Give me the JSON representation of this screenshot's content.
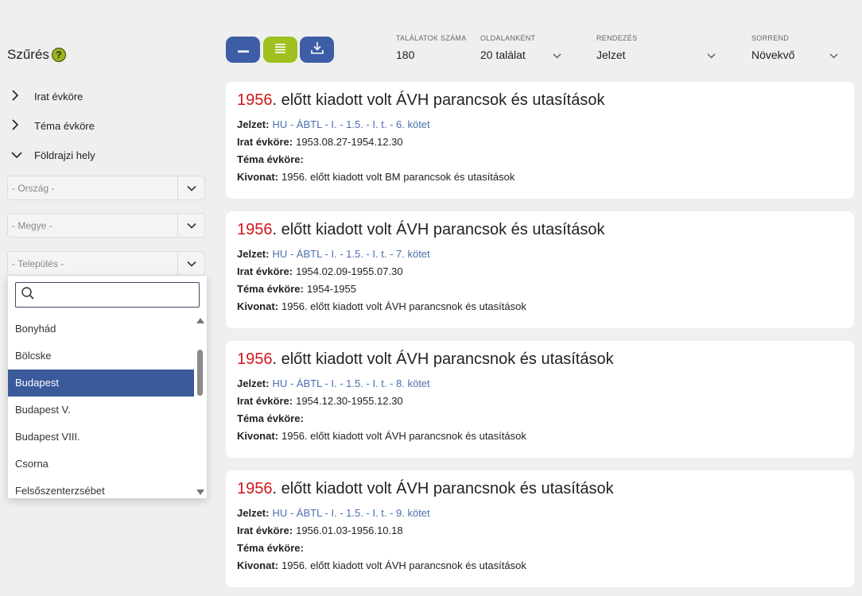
{
  "sidebar": {
    "title": "Szűrés",
    "help": "?",
    "facets": [
      {
        "label": "Irat évköre",
        "state": "collapsed"
      },
      {
        "label": "Téma évköre",
        "state": "collapsed"
      },
      {
        "label": "Földrajzi hely",
        "state": "expanded"
      }
    ],
    "selects": [
      {
        "placeholder": "- Ország -"
      },
      {
        "placeholder": "- Megye -"
      },
      {
        "placeholder": "- Település -"
      }
    ],
    "dropdown": {
      "search_value": "",
      "items": [
        "Bonyhád",
        "Bölcske",
        "Budapest",
        "Budapest V.",
        "Budapest VIII.",
        "Csorna",
        "Felsőszenterzsébet"
      ],
      "selected": "Budapest"
    }
  },
  "toolbar": {
    "results_label": "TALÁLATOK SZÁMA",
    "results_value": "180",
    "per_page_label": "OLDALANKÉNT",
    "per_page_value": "20 találat",
    "sort_label": "RENDEZÉS",
    "sort_value": "Jelzet",
    "order_label": "SORREND",
    "order_value": "Növekvő",
    "colors": {
      "blue": "#3d5ea6",
      "green": "#9fc01f"
    }
  },
  "labels": {
    "jelzet": "Jelzet:",
    "irat": "Irat évköre:",
    "tema": "Téma évköre:",
    "kivonat": "Kivonat:"
  },
  "results": [
    {
      "year": "1956",
      "title_rest": ". előtt kiadott volt ÁVH parancsok és utasítások",
      "jelzet": "HU - ÁBTL - I. - 1.5. - I. t. - 6. kötet",
      "irat": "1953.08.27-1954.12.30",
      "tema": "",
      "kivonat": "1956. előtt kiadott volt BM parancsok és utasítások"
    },
    {
      "year": "1956",
      "title_rest": ". előtt kiadott volt ÁVH parancsok és utasítások",
      "jelzet": "HU - ÁBTL - I. - 1.5. - I. t. - 7. kötet",
      "irat": "1954.02.09-1955.07.30",
      "tema": "1954-1955",
      "kivonat": "1956. előtt kiadott volt ÁVH parancsnok és utasítások"
    },
    {
      "year": "1956",
      "title_rest": ". előtt kiadott volt ÁVH parancsnok és utasítások",
      "jelzet": "HU - ÁBTL - I. - 1.5. - I. t. - 8. kötet",
      "irat": "1954.12.30-1955.12.30",
      "tema": "",
      "kivonat": "1956. előtt kiadott volt ÁVH parancsnok és utasítások"
    },
    {
      "year": "1956",
      "title_rest": ". előtt kiadott volt ÁVH parancsnok és utasítások",
      "jelzet": "HU - ÁBTL - I. - 1.5. - I. t. - 9. kötet",
      "irat": "1956.01.03-1956.10.18",
      "tema": "",
      "kivonat": "1956. előtt kiadott volt ÁVH parancsnok és utasítások"
    }
  ]
}
